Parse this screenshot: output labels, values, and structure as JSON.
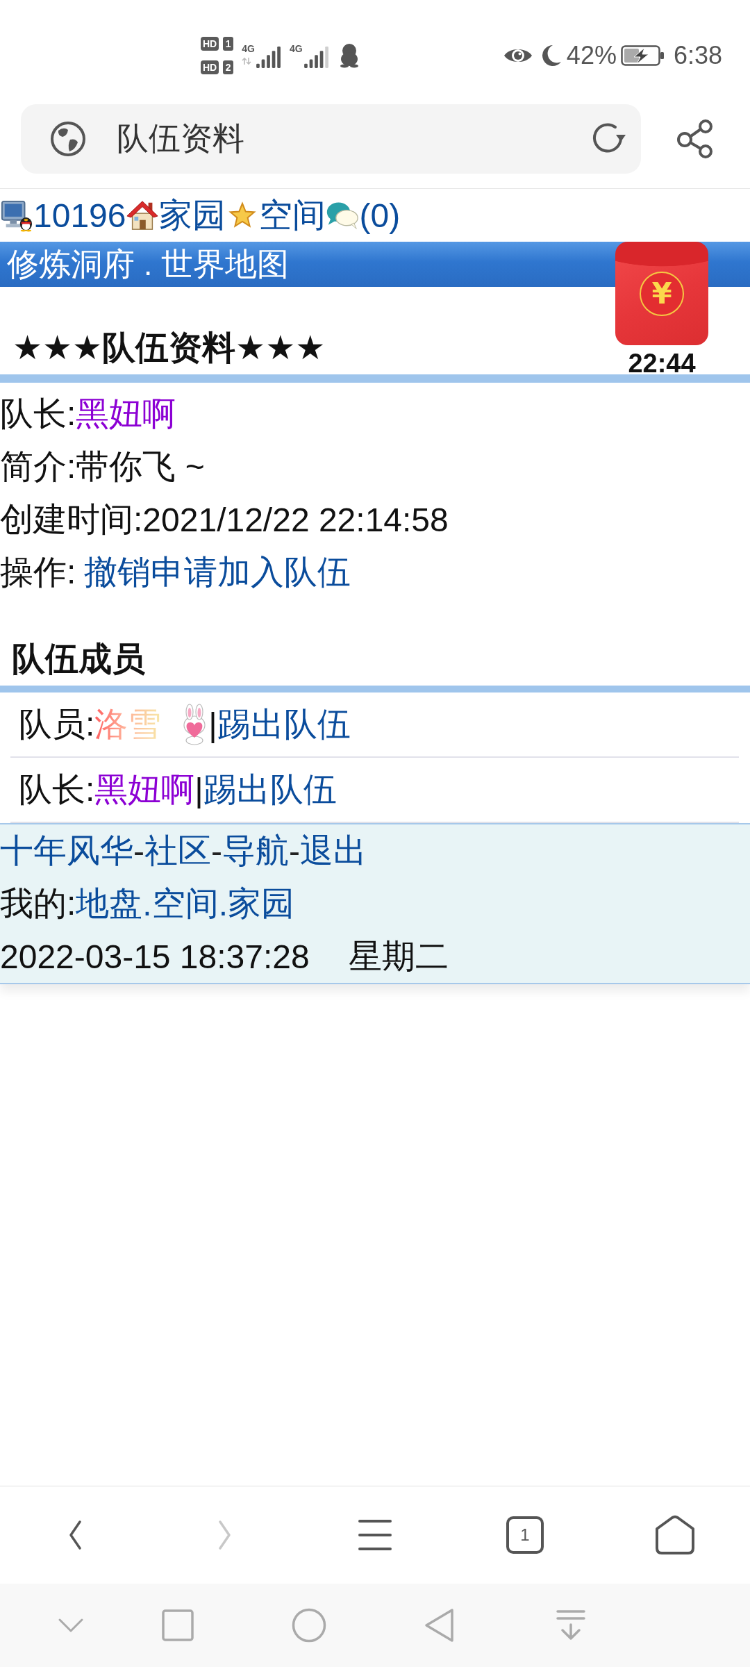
{
  "status_bar": {
    "sims": [
      {
        "label": "HD",
        "slot": "1"
      },
      {
        "label": "HD",
        "slot": "2"
      }
    ],
    "networks": [
      {
        "type": "4G",
        "data_active": true,
        "kind": "full"
      },
      {
        "type": "4G",
        "data_active": false,
        "kind": "partial"
      }
    ],
    "battery_text": "42%",
    "charging": true,
    "time": "6:38"
  },
  "address_bar": {
    "title": "队伍资料"
  },
  "top_links": [
    {
      "kind": "profile",
      "text": "10196"
    },
    {
      "kind": "home",
      "text": "家园"
    },
    {
      "kind": "space",
      "text": "空间"
    },
    {
      "kind": "chat",
      "text": "(0)"
    }
  ],
  "banner": {
    "title": "修炼洞府 . 世界地图"
  },
  "red_envelope": {
    "symbol": "¥",
    "timer": "22:44"
  },
  "team_section": {
    "heading": "★★★队伍资料★★★",
    "fields": [
      {
        "kind": "user",
        "label": "队长:",
        "value": "黑妞啊"
      },
      {
        "kind": "text",
        "label": "简介:",
        "value": "带你飞 ~"
      },
      {
        "kind": "text",
        "label": "创建时间:",
        "value": "2021/12/22 22:14:58"
      },
      {
        "kind": "link",
        "label": "操作:",
        "value": "撤销申请加入队伍"
      }
    ]
  },
  "members_section": {
    "heading": "队伍成员",
    "members": [
      {
        "kind": "gradient",
        "role": "队员:",
        "name": "洛雪",
        "badge": true,
        "separator": "|",
        "action": "踢出队伍"
      },
      {
        "kind": "user",
        "role": "队长:",
        "name": "黑妞啊",
        "badge": false,
        "separator": "|",
        "action": "踢出队伍"
      }
    ]
  },
  "footer": {
    "nav": [
      {
        "kind": "link",
        "text": "十年风华"
      },
      {
        "kind": "dash",
        "text": "-"
      },
      {
        "kind": "link",
        "text": "社区"
      },
      {
        "kind": "dash",
        "text": "-"
      },
      {
        "kind": "link",
        "text": "导航"
      },
      {
        "kind": "dash",
        "text": "-"
      },
      {
        "kind": "link",
        "text": "退出"
      }
    ],
    "mine_label": "我的:",
    "mine_links": [
      "地盘",
      "空间",
      "家园"
    ],
    "mine_separators": [
      ".",
      "."
    ],
    "datetime": "2022-03-15 18:37:28",
    "weekday": "星期二"
  },
  "browser_nav": [
    {
      "kind": "back",
      "disabled": false
    },
    {
      "kind": "forward",
      "disabled": true
    },
    {
      "kind": "menu",
      "disabled": false
    },
    {
      "kind": "tabs",
      "count": "1",
      "disabled": false
    },
    {
      "kind": "home",
      "disabled": false
    }
  ]
}
